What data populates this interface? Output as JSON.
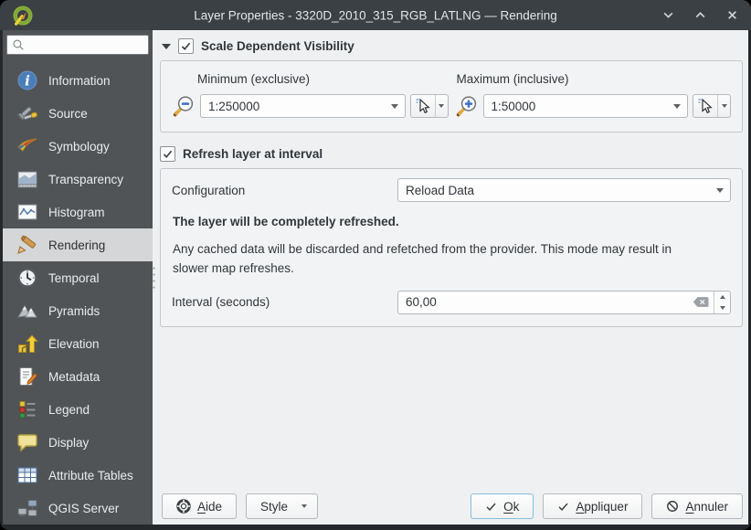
{
  "window": {
    "title": "Layer Properties - 3320D_2010_315_RGB_LATLNG — Rendering",
    "controls": [
      {
        "icon": "chevron-down-icon"
      },
      {
        "icon": "chevron-up-icon"
      },
      {
        "icon": "close-icon"
      }
    ]
  },
  "sidebar": {
    "search": {
      "placeholder": "",
      "icon": "search-icon"
    },
    "items": [
      {
        "label": "Information",
        "icon": "information-icon",
        "selected": false
      },
      {
        "label": "Source",
        "icon": "source-icon",
        "selected": false
      },
      {
        "label": "Symbology",
        "icon": "symbology-icon",
        "selected": false
      },
      {
        "label": "Transparency",
        "icon": "transparency-icon",
        "selected": false
      },
      {
        "label": "Histogram",
        "icon": "histogram-icon",
        "selected": false
      },
      {
        "label": "Rendering",
        "icon": "rendering-icon",
        "selected": true
      },
      {
        "label": "Temporal",
        "icon": "temporal-icon",
        "selected": false
      },
      {
        "label": "Pyramids",
        "icon": "pyramids-icon",
        "selected": false
      },
      {
        "label": "Elevation",
        "icon": "elevation-icon",
        "selected": false
      },
      {
        "label": "Metadata",
        "icon": "metadata-icon",
        "selected": false
      },
      {
        "label": "Legend",
        "icon": "legend-icon",
        "selected": false
      },
      {
        "label": "Display",
        "icon": "display-icon",
        "selected": false
      },
      {
        "label": "Attribute Tables",
        "icon": "attribute-tables-icon",
        "selected": false
      },
      {
        "label": "QGIS Server",
        "icon": "qgis-server-icon",
        "selected": false
      }
    ]
  },
  "scale_visibility": {
    "title": "Scale Dependent Visibility",
    "checked": true,
    "minimum": {
      "label": "Minimum (exclusive)",
      "value": "1:250000",
      "icon": "zoom-out-icon"
    },
    "maximum": {
      "label": "Maximum (inclusive)",
      "value": "1:50000",
      "icon": "zoom-in-icon"
    }
  },
  "refresh": {
    "title": "Refresh layer at interval",
    "checked": true,
    "configuration_label": "Configuration",
    "configuration_value": "Reload Data",
    "summary": "The layer will be completely refreshed.",
    "description": "Any cached data will be discarded and refetched from the provider. This mode may result in slower map refreshes.",
    "interval_label": "Interval (seconds)",
    "interval_value": "60,00"
  },
  "footer": {
    "help_label": "Aide",
    "style_label": "Style",
    "ok_label": "Ok",
    "apply_label": "Appliquer",
    "cancel_label": "Annuler"
  },
  "colors": {
    "accent": "#3daee9",
    "titlebar": "#3b4045",
    "sidebar_bg": "#515456",
    "selected_item_bg": "#d5d6d7",
    "content_bg": "#eff0f1",
    "ok_border": "#85bede"
  }
}
